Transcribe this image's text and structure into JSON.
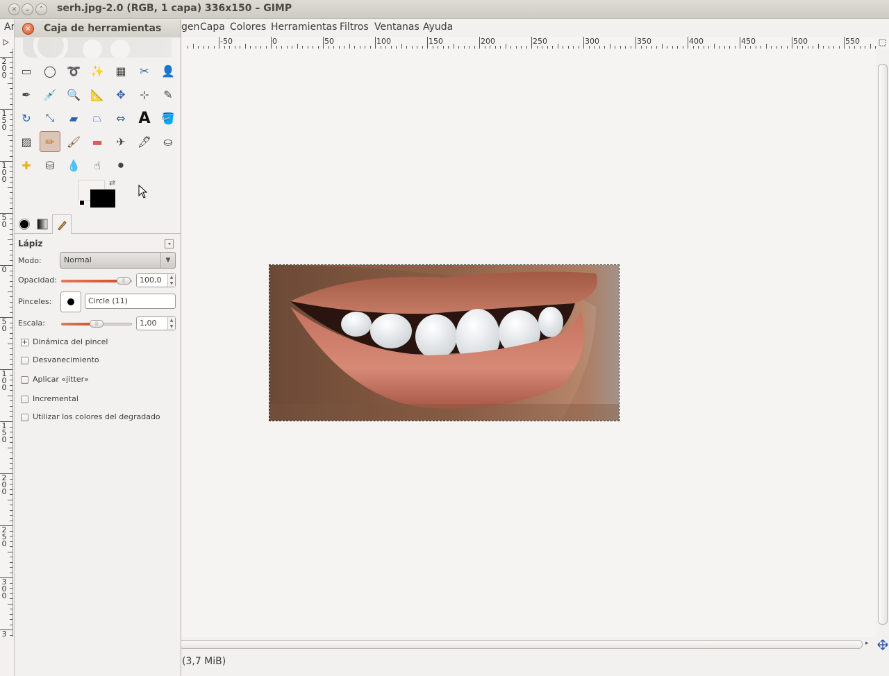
{
  "window": {
    "title": "serh.jpg-2.0 (RGB, 1 capa) 336x150 – GIMP"
  },
  "menubar": {
    "items": [
      "Ar",
      "gen",
      "Capa",
      "Colores",
      "Herramientas",
      "Filtros",
      "Ventanas",
      "Ayuda"
    ]
  },
  "ruler": {
    "h_labels": [
      "-50",
      "0",
      "50",
      "100",
      "150",
      "200",
      "250",
      "300",
      "350",
      "400",
      "450",
      "500",
      "550"
    ],
    "v_labels": [
      "2\n0\n0",
      "1\n5\n0",
      "1\n0\n0",
      "5\n0",
      "0",
      "5\n0",
      "1\n0\n0",
      "1\n5\n0",
      "2\n0\n0",
      "2\n5\n0",
      "3\n0\n0",
      "3"
    ]
  },
  "toolbox": {
    "title": "Caja de herramientas",
    "tools": [
      "rect-select-icon",
      "ellipse-select-icon",
      "free-select-icon",
      "fuzzy-select-icon",
      "color-select-icon",
      "scissors-icon",
      "foreground-select-icon",
      "paths-icon",
      "color-picker-icon",
      "zoom-icon",
      "measure-icon",
      "move-icon",
      "align-icon",
      "crop-icon",
      "rotate-icon",
      "scale-icon",
      "shear-icon",
      "perspective-icon",
      "flip-icon",
      "text-icon",
      "bucket-fill-icon",
      "blend-icon",
      "pencil-icon",
      "paintbrush-icon",
      "eraser-icon",
      "airbrush-icon",
      "ink-icon",
      "clone-icon",
      "heal-icon",
      "perspective-clone-icon",
      "blur-icon",
      "smudge-icon",
      "dodge-burn-icon"
    ],
    "active_tool": "pencil-icon"
  },
  "tool_options": {
    "title": "Lápiz",
    "mode_label": "Modo:",
    "mode_value": "Normal",
    "opacity_label": "Opacidad:",
    "opacity_value": "100,0",
    "opacity_fraction": 1.0,
    "brushes_label": "Pinceles:",
    "brush_value": "Circle (11)",
    "scale_label": "Escala:",
    "scale_value": "1,00",
    "scale_fraction": 0.5,
    "dynamics_label": "Dinámica del pincel",
    "checks": [
      "Desvanecimiento",
      "Aplicar «jitter»",
      "Incremental",
      "Utilizar los colores del degradado"
    ]
  },
  "status": {
    "text": "(3,7 MiB)"
  },
  "colors": {
    "foreground": "#000000",
    "background": "#f6f2ef",
    "active_tool_bg": "#dcc4b6"
  }
}
